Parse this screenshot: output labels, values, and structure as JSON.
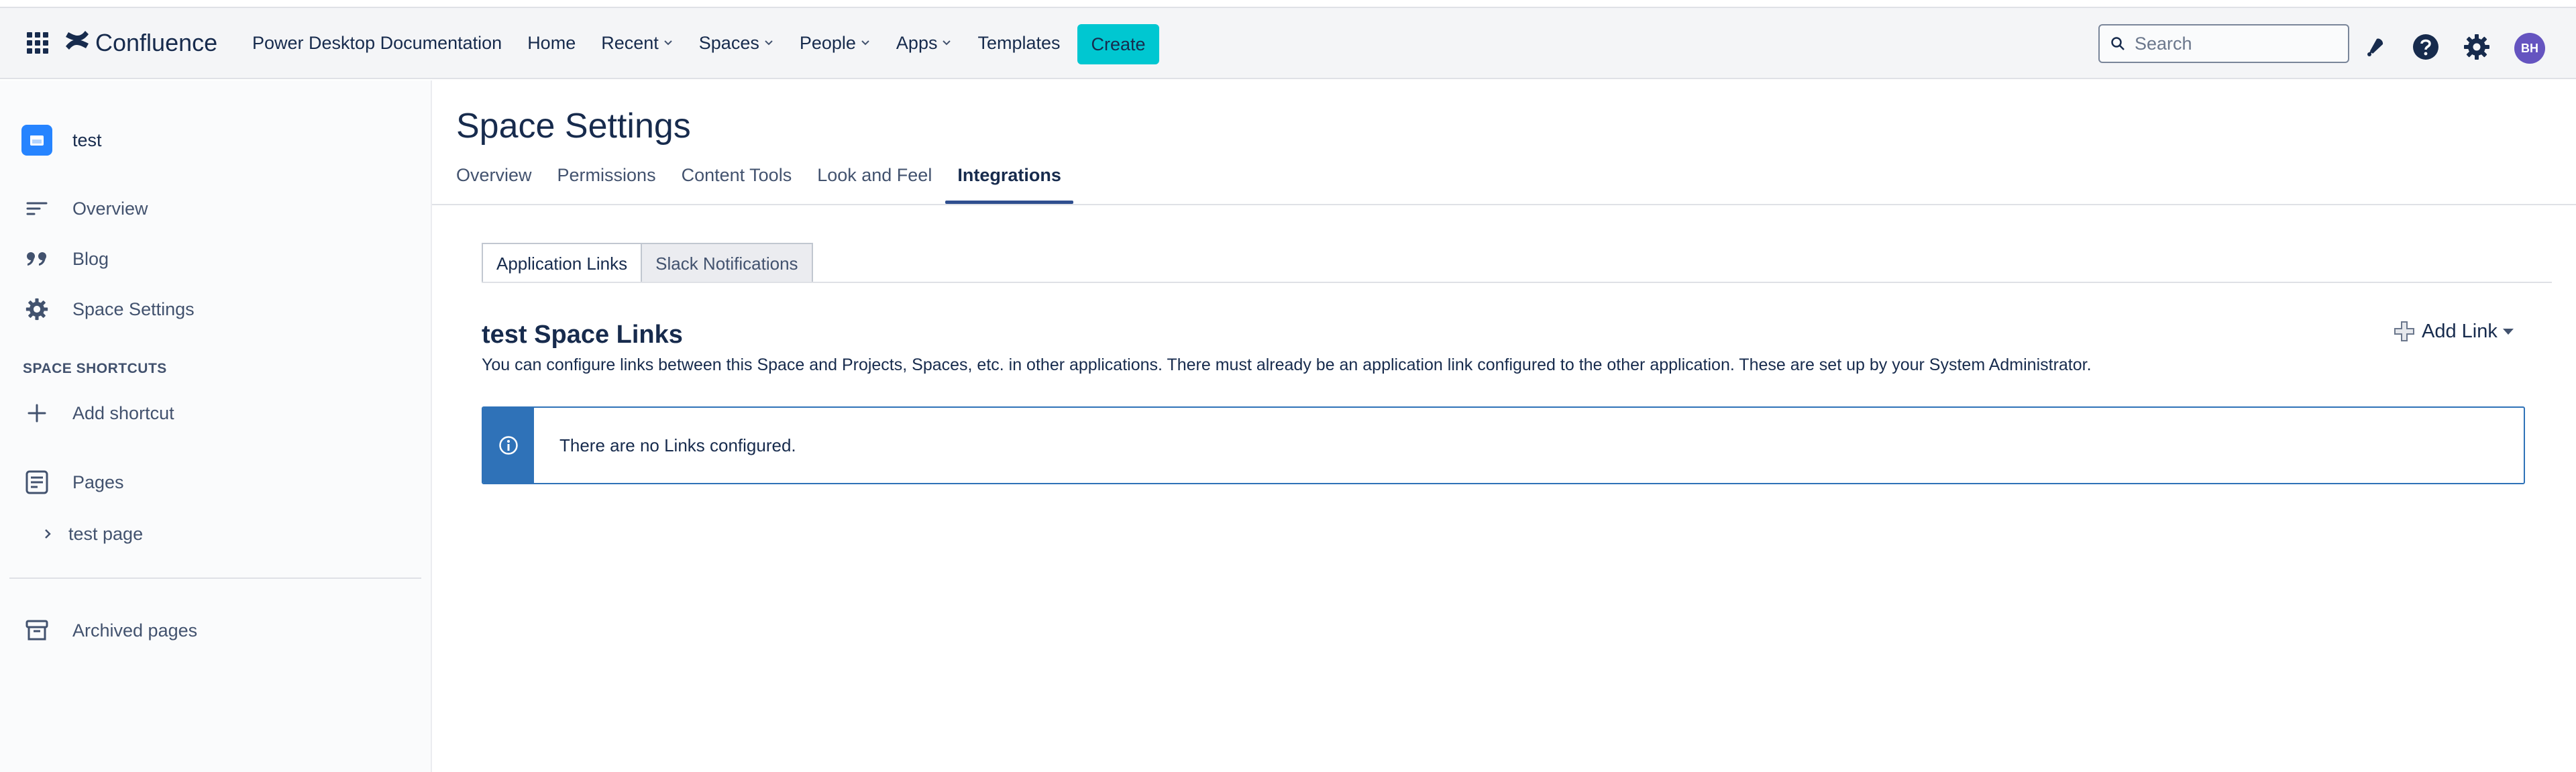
{
  "topbar": {
    "logo_text": "Confluence",
    "nav": [
      {
        "label": "Power Desktop Documentation",
        "dropdown": false
      },
      {
        "label": "Home",
        "dropdown": false
      },
      {
        "label": "Recent",
        "dropdown": true
      },
      {
        "label": "Spaces",
        "dropdown": true
      },
      {
        "label": "People",
        "dropdown": true
      },
      {
        "label": "Apps",
        "dropdown": true
      },
      {
        "label": "Templates",
        "dropdown": false
      }
    ],
    "create_label": "Create",
    "search_placeholder": "Search",
    "avatar_initials": "BH",
    "icons": [
      "app-switcher-icon",
      "notifications-icon",
      "help-icon",
      "settings-icon"
    ]
  },
  "sidebar": {
    "space_name": "test",
    "items": [
      {
        "label": "Overview",
        "icon": "overview-icon"
      },
      {
        "label": "Blog",
        "icon": "blog-quote-icon"
      },
      {
        "label": "Space Settings",
        "icon": "gear-icon"
      }
    ],
    "shortcuts_title": "SPACE SHORTCUTS",
    "add_shortcut_label": "Add shortcut",
    "pages_label": "Pages",
    "tree": [
      {
        "label": "test page"
      }
    ],
    "archived_label": "Archived pages"
  },
  "main": {
    "title": "Space Settings",
    "tabs": [
      {
        "label": "Overview",
        "active": false
      },
      {
        "label": "Permissions",
        "active": false
      },
      {
        "label": "Content Tools",
        "active": false
      },
      {
        "label": "Look and Feel",
        "active": false
      },
      {
        "label": "Integrations",
        "active": true
      }
    ],
    "subtabs": [
      {
        "label": "Application Links",
        "active": true
      },
      {
        "label": "Slack Notifications",
        "active": false
      }
    ],
    "section_title": "test Space Links",
    "section_desc": "You can configure links between this Space and Projects, Spaces, etc. in other applications. There must already be an application link configured to the other application. These are set up by your System Administrator.",
    "add_link_label": "Add Link",
    "info_message": "There are no Links configured."
  },
  "colors": {
    "accent_create": "#00c7d1",
    "tab_underline": "#2f4f8f",
    "info_blue": "#2f72b8",
    "avatar": "#6554c0",
    "space_avatar": "#2684ff"
  }
}
